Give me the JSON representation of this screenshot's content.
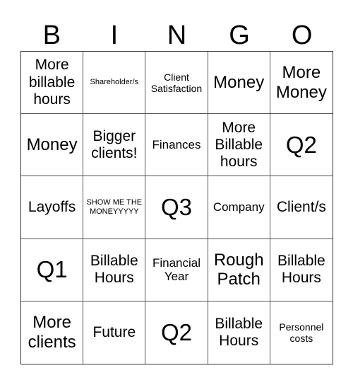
{
  "header": [
    "B",
    "I",
    "N",
    "G",
    "O"
  ],
  "cells": [
    {
      "text": "More billable hours",
      "size": "s-m"
    },
    {
      "text": "Shareholder/s",
      "size": "s-xxs"
    },
    {
      "text": "Client Satisfaction",
      "size": "s-xs"
    },
    {
      "text": "Money",
      "size": "s-l"
    },
    {
      "text": "More Money",
      "size": "s-l"
    },
    {
      "text": "Money",
      "size": "s-l"
    },
    {
      "text": "Bigger clients!",
      "size": "s-m"
    },
    {
      "text": "Finances",
      "size": "s-s"
    },
    {
      "text": "More Billable hours",
      "size": "s-m"
    },
    {
      "text": "Q2",
      "size": "s-xl"
    },
    {
      "text": "Layoffs",
      "size": "s-m"
    },
    {
      "text": "SHOW ME THE MONEYYYYY",
      "size": "s-xxs"
    },
    {
      "text": "Q3",
      "size": "s-xl"
    },
    {
      "text": "Company",
      "size": "s-s"
    },
    {
      "text": "Client/s",
      "size": "s-m"
    },
    {
      "text": "Q1",
      "size": "s-xl"
    },
    {
      "text": "Billable Hours",
      "size": "s-m"
    },
    {
      "text": "Financial Year",
      "size": "s-s"
    },
    {
      "text": "Rough Patch",
      "size": "s-l"
    },
    {
      "text": "Billable Hours",
      "size": "s-m"
    },
    {
      "text": "More clients",
      "size": "s-l"
    },
    {
      "text": "Future",
      "size": "s-m"
    },
    {
      "text": "Q2",
      "size": "s-xl"
    },
    {
      "text": "Billable Hours",
      "size": "s-m"
    },
    {
      "text": "Personnel costs",
      "size": "s-xs"
    }
  ]
}
